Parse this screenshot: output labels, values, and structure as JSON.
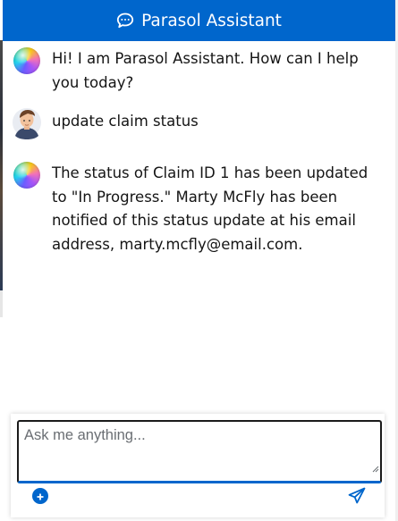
{
  "header": {
    "title": "Parasol Assistant",
    "icon": "chat-bubbles-icon"
  },
  "messages": [
    {
      "role": "assistant",
      "avatar": "assistant-orb-avatar",
      "text": "Hi! I am Parasol Assistant. How can I help you today?"
    },
    {
      "role": "user",
      "avatar": "user-avatar",
      "text": "update claim status"
    },
    {
      "role": "assistant",
      "avatar": "assistant-orb-avatar",
      "text": "The status of Claim ID 1 has been updated to \"In Progress.\" Marty McFly has been notified of this status update at his email address, marty.mcfly@email.com."
    }
  ],
  "composer": {
    "placeholder": "Ask me anything...",
    "value": "",
    "attach_icon": "plus-circle-icon",
    "send_icon": "paper-plane-icon"
  },
  "colors": {
    "accent": "#0066cc",
    "text": "#151515"
  }
}
